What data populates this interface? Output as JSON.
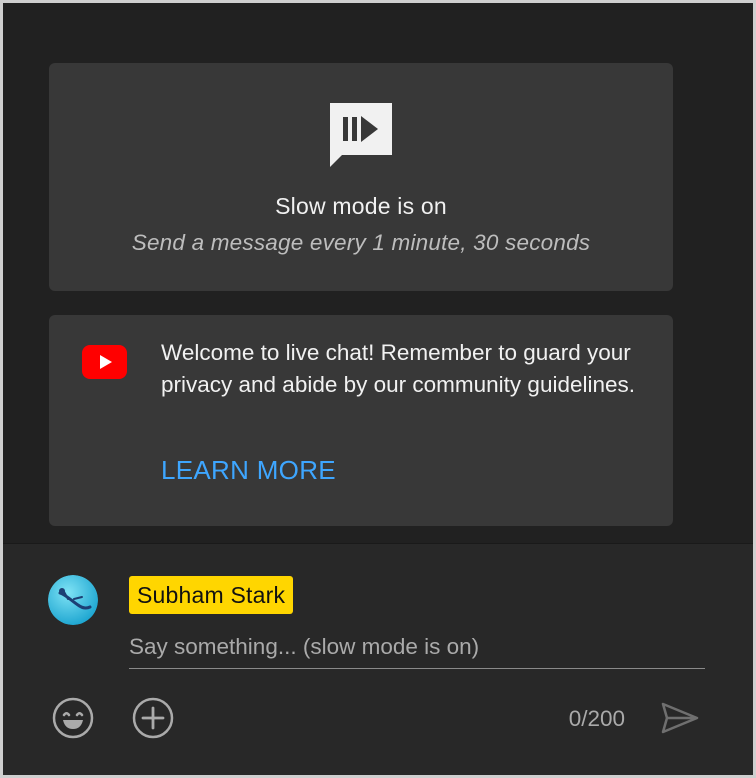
{
  "slow_mode": {
    "icon": "slow-mode-icon",
    "title": "Slow mode is on",
    "subtitle": "Send a message every 1 minute, 30 seconds"
  },
  "welcome": {
    "icon": "youtube-logo-icon",
    "message": "Welcome to live chat! Remember to guard your privacy and abide by our community guidelines.",
    "link_label": "LEARN MORE"
  },
  "composer": {
    "avatar_icon": "avatar",
    "author_name": "Subham Stark",
    "input_value": "",
    "input_placeholder": "Say something... (slow mode is on)",
    "char_counter": "0/200",
    "emoji_icon": "emoji-icon",
    "add_icon": "add-circle-icon",
    "send_icon": "send-icon"
  },
  "colors": {
    "background": "#212121",
    "card": "#383838",
    "composer": "#282828",
    "link": "#3ea6ff",
    "author_chip": "#ffd600",
    "youtube_red": "#ff0000"
  }
}
